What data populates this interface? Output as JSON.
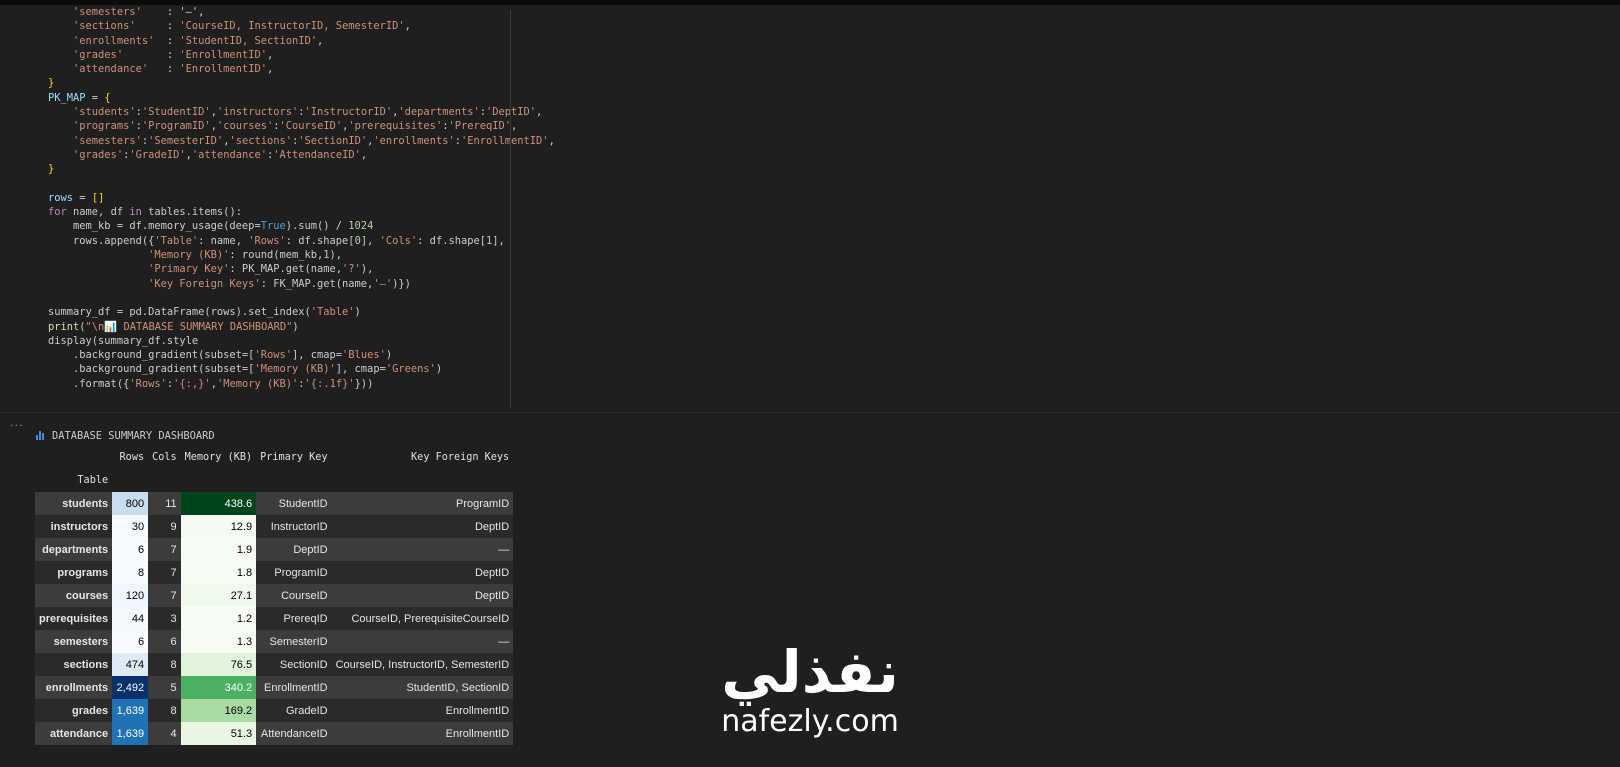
{
  "code_lines": [
    [
      [
        "s",
        "    'semesters'"
      ],
      [
        "t",
        "    : '—',"
      ]
    ],
    [
      [
        "s",
        "    'sections'"
      ],
      [
        "t",
        "     : "
      ],
      [
        "s",
        "'CourseID, InstructorID, SemesterID'"
      ],
      [
        "t",
        ","
      ]
    ],
    [
      [
        "s",
        "    'enrollments'"
      ],
      [
        "t",
        "  : "
      ],
      [
        "s",
        "'StudentID, SectionID'"
      ],
      [
        "t",
        ","
      ]
    ],
    [
      [
        "s",
        "    'grades'"
      ],
      [
        "t",
        "       : "
      ],
      [
        "s",
        "'EnrollmentID'"
      ],
      [
        "t",
        ","
      ]
    ],
    [
      [
        "s",
        "    'attendance'"
      ],
      [
        "t",
        "   : "
      ],
      [
        "s",
        "'EnrollmentID'"
      ],
      [
        "t",
        ","
      ]
    ],
    [
      [
        "b",
        "}"
      ]
    ],
    [
      [
        "v",
        "PK_MAP"
      ],
      [
        "t",
        " = "
      ],
      [
        "b",
        "{"
      ]
    ],
    [
      [
        "t",
        "    "
      ],
      [
        "s",
        "'students'"
      ],
      [
        "t",
        ":"
      ],
      [
        "s",
        "'StudentID'"
      ],
      [
        "t",
        ","
      ],
      [
        "s",
        "'instructors'"
      ],
      [
        "t",
        ":"
      ],
      [
        "s",
        "'InstructorID'"
      ],
      [
        "t",
        ","
      ],
      [
        "s",
        "'departments'"
      ],
      [
        "t",
        ":"
      ],
      [
        "s",
        "'DeptID'"
      ],
      [
        "t",
        ","
      ]
    ],
    [
      [
        "t",
        "    "
      ],
      [
        "s",
        "'programs'"
      ],
      [
        "t",
        ":"
      ],
      [
        "s",
        "'ProgramID'"
      ],
      [
        "t",
        ","
      ],
      [
        "s",
        "'courses'"
      ],
      [
        "t",
        ":"
      ],
      [
        "s",
        "'CourseID'"
      ],
      [
        "t",
        ","
      ],
      [
        "s",
        "'prerequisites'"
      ],
      [
        "t",
        ":"
      ],
      [
        "s",
        "'PrereqID'"
      ],
      [
        "t",
        ","
      ]
    ],
    [
      [
        "t",
        "    "
      ],
      [
        "s",
        "'semesters'"
      ],
      [
        "t",
        ":"
      ],
      [
        "s",
        "'SemesterID'"
      ],
      [
        "t",
        ","
      ],
      [
        "s",
        "'sections'"
      ],
      [
        "t",
        ":"
      ],
      [
        "s",
        "'SectionID'"
      ],
      [
        "t",
        ","
      ],
      [
        "s",
        "'enrollments'"
      ],
      [
        "t",
        ":"
      ],
      [
        "s",
        "'EnrollmentID'"
      ],
      [
        "t",
        ","
      ]
    ],
    [
      [
        "t",
        "    "
      ],
      [
        "s",
        "'grades'"
      ],
      [
        "t",
        ":"
      ],
      [
        "s",
        "'GradeID'"
      ],
      [
        "t",
        ","
      ],
      [
        "s",
        "'attendance'"
      ],
      [
        "t",
        ":"
      ],
      [
        "s",
        "'AttendanceID'"
      ],
      [
        "t",
        ","
      ]
    ],
    [
      [
        "b",
        "}"
      ]
    ],
    [
      [
        "t",
        ""
      ]
    ],
    [
      [
        "v",
        "rows"
      ],
      [
        "t",
        " = "
      ],
      [
        "b",
        "[]"
      ]
    ],
    [
      [
        "k",
        "for"
      ],
      [
        "t",
        " name, df "
      ],
      [
        "k",
        "in"
      ],
      [
        "t",
        " tables.items():"
      ]
    ],
    [
      [
        "t",
        "    mem_kb = df.memory_usage(deep="
      ],
      [
        "c",
        "True"
      ],
      [
        "t",
        ").sum() / "
      ],
      [
        "n",
        "1024"
      ]
    ],
    [
      [
        "t",
        "    rows.append({"
      ],
      [
        "s",
        "'Table'"
      ],
      [
        "t",
        ": name, "
      ],
      [
        "s",
        "'Rows'"
      ],
      [
        "t",
        ": df.shape["
      ],
      [
        "n",
        "0"
      ],
      [
        "t",
        "], "
      ],
      [
        "s",
        "'Cols'"
      ],
      [
        "t",
        ": df.shape["
      ],
      [
        "n",
        "1"
      ],
      [
        "t",
        "],"
      ]
    ],
    [
      [
        "t",
        "                "
      ],
      [
        "s",
        "'Memory (KB)'"
      ],
      [
        "t",
        ": round(mem_kb,"
      ],
      [
        "n",
        "1"
      ],
      [
        "t",
        "),"
      ]
    ],
    [
      [
        "t",
        "                "
      ],
      [
        "s",
        "'Primary Key'"
      ],
      [
        "t",
        ": PK_MAP.get(name,"
      ],
      [
        "s",
        "'?'"
      ],
      [
        "t",
        "),"
      ]
    ],
    [
      [
        "t",
        "                "
      ],
      [
        "s",
        "'Key Foreign Keys'"
      ],
      [
        "t",
        ": FK_MAP.get(name,"
      ],
      [
        "s",
        "'—'"
      ],
      [
        "t",
        ")})"
      ]
    ],
    [
      [
        "t",
        ""
      ]
    ],
    [
      [
        "t",
        "summary_df = pd.DataFrame(rows).set_index("
      ],
      [
        "s",
        "'Table'"
      ],
      [
        "t",
        ")"
      ]
    ],
    [
      [
        "f",
        "print"
      ],
      [
        "t",
        "("
      ],
      [
        "s",
        "\"\\n📊 DATABASE SUMMARY DASHBOARD\""
      ],
      [
        "t",
        ")"
      ]
    ],
    [
      [
        "t",
        "display(summary_df.style"
      ]
    ],
    [
      [
        "t",
        "    .background_gradient(subset=["
      ],
      [
        "s",
        "'Rows'"
      ],
      [
        "t",
        "], cmap="
      ],
      [
        "s",
        "'Blues'"
      ],
      [
        "t",
        ")"
      ]
    ],
    [
      [
        "t",
        "    .background_gradient(subset=["
      ],
      [
        "s",
        "'Memory (KB)'"
      ],
      [
        "t",
        "], cmap="
      ],
      [
        "s",
        "'Greens'"
      ],
      [
        "t",
        ")"
      ]
    ],
    [
      [
        "t",
        "    .format({"
      ],
      [
        "s",
        "'Rows'"
      ],
      [
        "t",
        ":"
      ],
      [
        "s",
        "'{:,}'"
      ],
      [
        "t",
        ","
      ],
      [
        "s",
        "'Memory (KB)'"
      ],
      [
        "t",
        ":"
      ],
      [
        "s",
        "'{:.1f}'"
      ],
      [
        "t",
        "}))"
      ]
    ]
  ],
  "output": {
    "more_label": "...",
    "title": "DATABASE SUMMARY DASHBOARD",
    "index_name": "Table",
    "columns": [
      "Rows",
      "Cols",
      "Memory (KB)",
      "Primary Key",
      "Key Foreign Keys"
    ],
    "rows": [
      {
        "table": "students",
        "rows": "800",
        "rows_bg": "#c8ddf0",
        "rows_fg": "#000000",
        "cols": "11",
        "mem": "438.6",
        "mem_bg": "#00441b",
        "mem_fg": "#ffffff",
        "pk": "StudentID",
        "fk": "ProgramID"
      },
      {
        "table": "instructors",
        "rows": "30",
        "rows_bg": "#f6faff",
        "rows_fg": "#000000",
        "cols": "9",
        "mem": "12.9",
        "mem_bg": "#f5fbf2",
        "mem_fg": "#000000",
        "pk": "InstructorID",
        "fk": "DeptID"
      },
      {
        "table": "departments",
        "rows": "6",
        "rows_bg": "#f7fbff",
        "rows_fg": "#000000",
        "cols": "7",
        "mem": "1.9",
        "mem_bg": "#f7fcf5",
        "mem_fg": "#000000",
        "pk": "DeptID",
        "fk": "—"
      },
      {
        "table": "programs",
        "rows": "8",
        "rows_bg": "#f7fbff",
        "rows_fg": "#000000",
        "cols": "7",
        "mem": "1.8",
        "mem_bg": "#f7fcf5",
        "mem_fg": "#000000",
        "pk": "ProgramID",
        "fk": "DeptID"
      },
      {
        "table": "courses",
        "rows": "120",
        "rows_bg": "#f0f6fd",
        "rows_fg": "#000000",
        "cols": "7",
        "mem": "27.1",
        "mem_bg": "#eff9ec",
        "mem_fg": "#000000",
        "pk": "CourseID",
        "fk": "DeptID"
      },
      {
        "table": "prerequisites",
        "rows": "44",
        "rows_bg": "#f4f9fe",
        "rows_fg": "#000000",
        "cols": "3",
        "mem": "1.2",
        "mem_bg": "#f7fcf5",
        "mem_fg": "#000000",
        "pk": "PrereqID",
        "fk": "CourseID, PrerequisiteCourseID"
      },
      {
        "table": "semesters",
        "rows": "6",
        "rows_bg": "#f7fbff",
        "rows_fg": "#000000",
        "cols": "6",
        "mem": "1.3",
        "mem_bg": "#f7fcf5",
        "mem_fg": "#000000",
        "pk": "SemesterID",
        "fk": "—"
      },
      {
        "table": "sections",
        "rows": "474",
        "rows_bg": "#deebf7",
        "rows_fg": "#000000",
        "cols": "8",
        "mem": "76.5",
        "mem_bg": "#e1f3dc",
        "mem_fg": "#000000",
        "pk": "SectionID",
        "fk": "CourseID, InstructorID, SemesterID"
      },
      {
        "table": "enrollments",
        "rows": "2,492",
        "rows_bg": "#08306b",
        "rows_fg": "#ffffff",
        "cols": "5",
        "mem": "340.2",
        "mem_bg": "#4bb062",
        "mem_fg": "#ffffff",
        "pk": "EnrollmentID",
        "fk": "StudentID, SectionID"
      },
      {
        "table": "grades",
        "rows": "1,639",
        "rows_bg": "#2171b5",
        "rows_fg": "#ffffff",
        "cols": "8",
        "mem": "169.2",
        "mem_bg": "#a9dca3",
        "mem_fg": "#000000",
        "pk": "GradeID",
        "fk": "EnrollmentID"
      },
      {
        "table": "attendance",
        "rows": "1,639",
        "rows_bg": "#2171b5",
        "rows_fg": "#ffffff",
        "cols": "4",
        "mem": "51.3",
        "mem_bg": "#e8f6e3",
        "mem_fg": "#000000",
        "pk": "AttendanceID",
        "fk": "EnrollmentID"
      }
    ]
  },
  "watermark": {
    "arabic": "نفذلي",
    "latin": "nafezly.com"
  },
  "colors": {
    "background": "#1f1f1f",
    "string": "#ce9178",
    "keyword": "#c586c0",
    "number": "#b5cea8",
    "chart_icon": "#4a8ad4"
  }
}
